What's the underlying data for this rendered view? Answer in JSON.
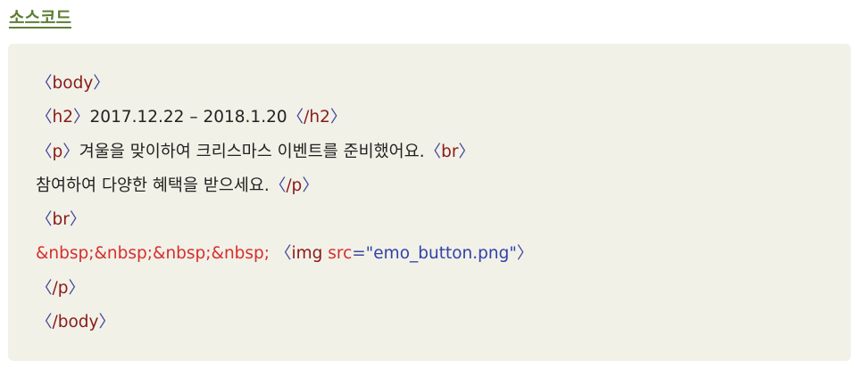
{
  "heading": "소스코드",
  "code": {
    "l1_tag": "body",
    "l2_open_tag": "h2",
    "l2_text": "2017.12.22 – 2018.1.20",
    "l2_close_tag": "/h2",
    "l3_open_tag": "p",
    "l3_text": "겨울을 맞이하여 크리스마스 이벤트를 준비했어요.",
    "l3_br_tag": "br",
    "l4_text": "참여하여 다양한 혜택을 받으세요.",
    "l4_close_tag": "/p",
    "l5_tag": "br",
    "l6_entities": "&nbsp;&nbsp;&nbsp;&nbsp;",
    "l6_tag": "img",
    "l6_attr": "src",
    "l6_eq": "=",
    "l6_value": "\"emo_button.png\"",
    "l7_tag": "/p",
    "l8_tag": "/body"
  }
}
